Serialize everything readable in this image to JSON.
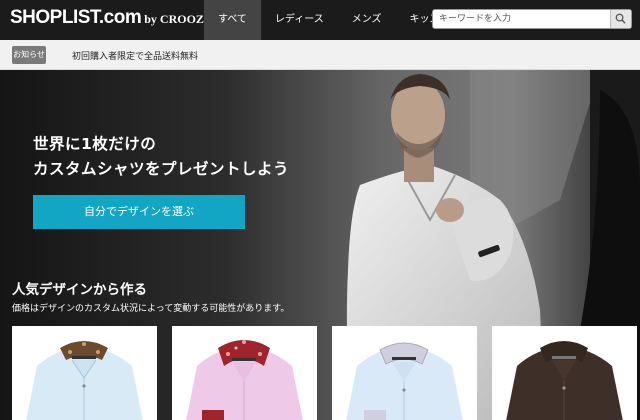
{
  "header": {
    "logo": {
      "main": "SHOPLIST.com",
      "by": "by CROOZ"
    },
    "nav": [
      {
        "label": "すべて",
        "active": true
      },
      {
        "label": "レディース",
        "active": false
      },
      {
        "label": "メンズ",
        "active": false
      },
      {
        "label": "キッズ",
        "active": false
      }
    ],
    "search": {
      "placeholder": "キーワードを入力",
      "icon": "search-icon"
    }
  },
  "notice": {
    "badge": "お知らせ",
    "text": "初回購入者限定で全品送料無料"
  },
  "hero": {
    "headline_line1": "世界に1枚だけの",
    "headline_line2": "カスタムシャツをプレゼントしよう",
    "cta_label": "自分でデザインを選ぶ",
    "section_title": "人気デザインから作る",
    "section_note": "価格はデザインのカスタム状況によって変動する可能性があります。"
  },
  "products": [
    {
      "body_color": "#d7eaf6",
      "collar_color": "#6b4a2f",
      "accent": "floral-collar"
    },
    {
      "body_color": "#efc9e8",
      "collar_color": "#a0242c",
      "accent": "floral-collar-and-cuff"
    },
    {
      "body_color": "#d9e9f7",
      "collar_color": "#cfcfe0",
      "accent": "contrast-collar"
    },
    {
      "body_color": "#3e3029",
      "collar_color": "#3a2d26",
      "accent": "dark"
    }
  ],
  "colors": {
    "accent_cta": "#13a6c4",
    "header_bg": "#1b1b1b",
    "nav_active_bg": "#444444",
    "notice_bg": "#f1f1f1"
  }
}
